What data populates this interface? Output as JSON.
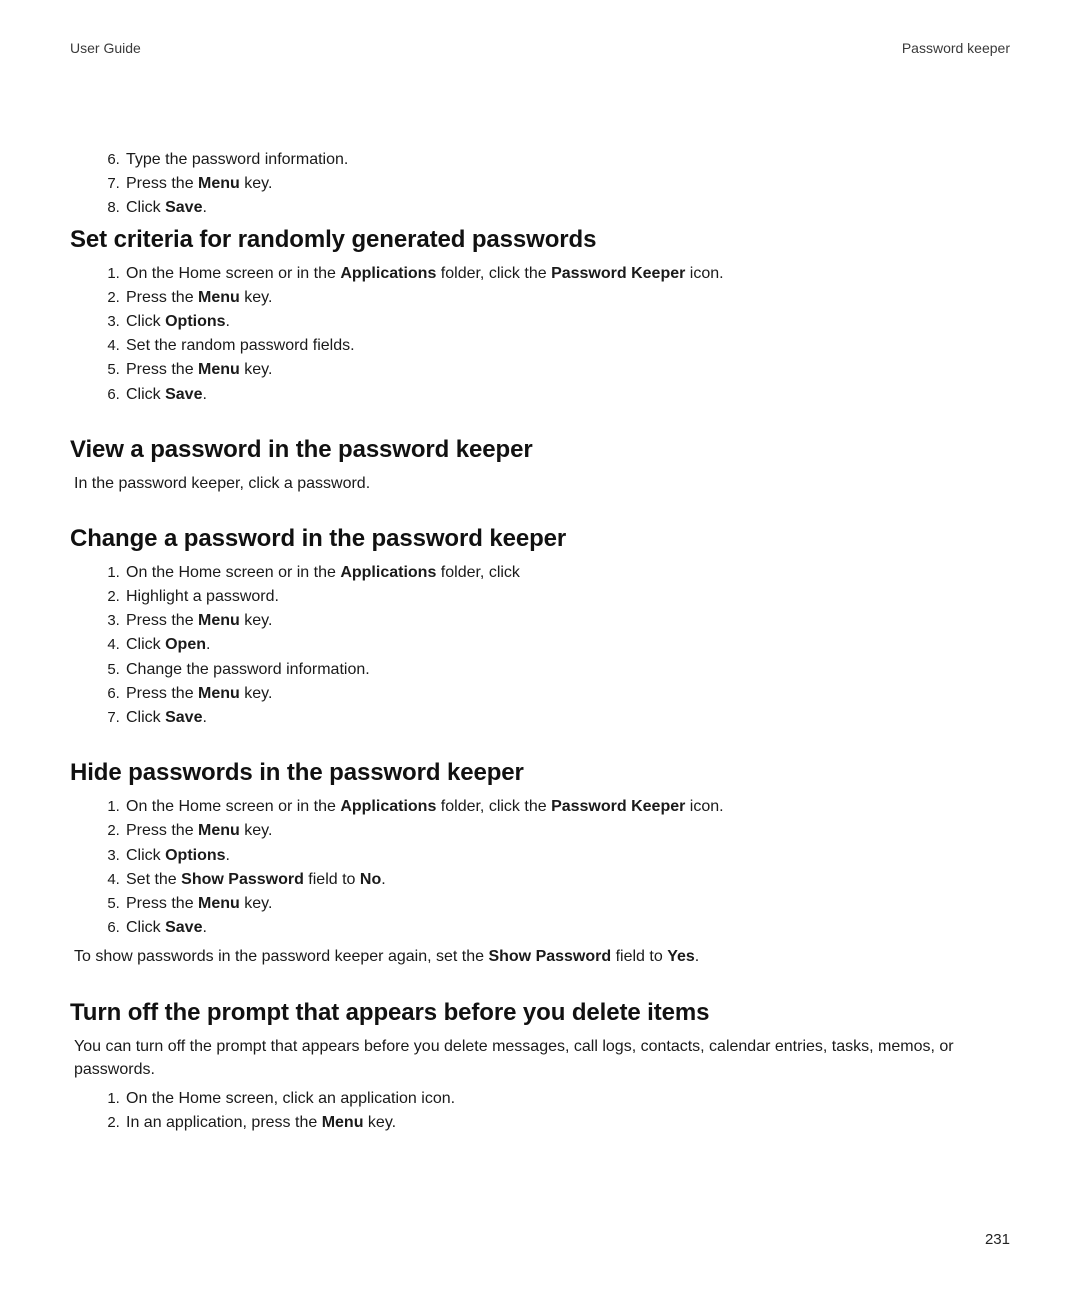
{
  "header": {
    "left": "User Guide",
    "right": "Password keeper"
  },
  "page_number": "231",
  "intro_list": {
    "start": 6,
    "items": [
      [
        {
          "t": "Type the password information."
        }
      ],
      [
        {
          "t": "Press the "
        },
        {
          "b": "Menu"
        },
        {
          "t": " key."
        }
      ],
      [
        {
          "t": "Click "
        },
        {
          "b": "Save"
        },
        {
          "t": "."
        }
      ]
    ]
  },
  "sections": [
    {
      "heading": "Set criteria for randomly generated passwords",
      "list": {
        "start": 1,
        "items": [
          [
            {
              "t": "On the Home screen or in the "
            },
            {
              "b": "Applications"
            },
            {
              "t": " folder, click the "
            },
            {
              "b": "Password Keeper"
            },
            {
              "t": " icon."
            }
          ],
          [
            {
              "t": "Press the "
            },
            {
              "b": "Menu"
            },
            {
              "t": " key."
            }
          ],
          [
            {
              "t": "Click "
            },
            {
              "b": "Options"
            },
            {
              "t": "."
            }
          ],
          [
            {
              "t": "Set the random password fields."
            }
          ],
          [
            {
              "t": "Press the "
            },
            {
              "b": "Menu"
            },
            {
              "t": " key."
            }
          ],
          [
            {
              "t": "Click "
            },
            {
              "b": "Save"
            },
            {
              "t": "."
            }
          ]
        ]
      }
    },
    {
      "heading": "View a password in the password keeper",
      "paragraphs_before": [
        [
          {
            "t": "In the password keeper, click a password."
          }
        ]
      ]
    },
    {
      "heading": "Change a password in the password keeper",
      "list": {
        "start": 1,
        "items": [
          [
            {
              "t": "On the Home screen or in the "
            },
            {
              "b": "Applications"
            },
            {
              "t": " folder, click"
            }
          ],
          [
            {
              "t": "Highlight a password."
            }
          ],
          [
            {
              "t": "Press the "
            },
            {
              "b": "Menu"
            },
            {
              "t": " key."
            }
          ],
          [
            {
              "t": "Click "
            },
            {
              "b": "Open"
            },
            {
              "t": "."
            }
          ],
          [
            {
              "t": "Change the password information."
            }
          ],
          [
            {
              "t": "Press the "
            },
            {
              "b": "Menu"
            },
            {
              "t": " key."
            }
          ],
          [
            {
              "t": "Click "
            },
            {
              "b": "Save"
            },
            {
              "t": "."
            }
          ]
        ]
      }
    },
    {
      "heading": "Hide passwords in the password keeper",
      "list": {
        "start": 1,
        "items": [
          [
            {
              "t": "On the Home screen or in the "
            },
            {
              "b": "Applications"
            },
            {
              "t": " folder, click the "
            },
            {
              "b": "Password Keeper"
            },
            {
              "t": " icon."
            }
          ],
          [
            {
              "t": "Press the "
            },
            {
              "b": "Menu"
            },
            {
              "t": " key."
            }
          ],
          [
            {
              "t": "Click "
            },
            {
              "b": "Options"
            },
            {
              "t": "."
            }
          ],
          [
            {
              "t": "Set the "
            },
            {
              "b": "Show Password"
            },
            {
              "t": " field to "
            },
            {
              "b": "No"
            },
            {
              "t": "."
            }
          ],
          [
            {
              "t": "Press the "
            },
            {
              "b": "Menu"
            },
            {
              "t": " key."
            }
          ],
          [
            {
              "t": "Click "
            },
            {
              "b": "Save"
            },
            {
              "t": "."
            }
          ]
        ]
      },
      "paragraphs_after": [
        [
          {
            "t": "To show passwords in the password keeper again, set the "
          },
          {
            "b": "Show Password"
          },
          {
            "t": " field to "
          },
          {
            "b": "Yes"
          },
          {
            "t": "."
          }
        ]
      ]
    },
    {
      "heading": "Turn off the prompt that appears before you delete items",
      "paragraphs_before": [
        [
          {
            "t": "You can turn off the prompt that appears before you delete messages, call logs, contacts, calendar entries, tasks, memos, or passwords."
          }
        ]
      ],
      "list": {
        "start": 1,
        "items": [
          [
            {
              "t": "On the Home screen, click an application icon."
            }
          ],
          [
            {
              "t": "In an application, press the "
            },
            {
              "b": "Menu"
            },
            {
              "t": " key."
            }
          ]
        ]
      }
    }
  ]
}
